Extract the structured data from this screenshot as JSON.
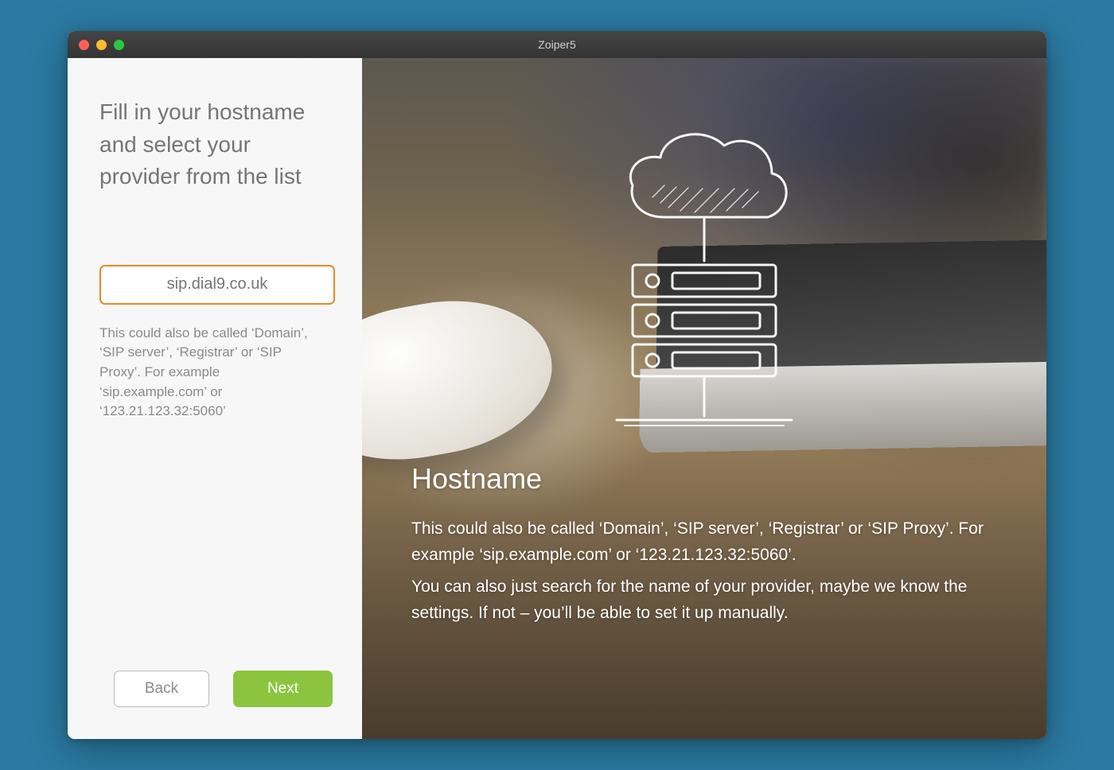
{
  "window": {
    "title": "Zoiper5"
  },
  "left": {
    "heading": "Fill in your hostname and select your provider from the list",
    "hostname_value": "sip.dial9.co.uk",
    "helper": "This could also be called ‘Domain’, ‘SIP server’, ‘Registrar’ or ‘SIP Proxy’. For example ‘sip.example.com’ or ‘123.21.123.32:5060’"
  },
  "buttons": {
    "back": "Back",
    "next": "Next"
  },
  "right": {
    "heading": "Hostname",
    "para1": "This could also be called ‘Domain’, ‘SIP server’, ‘Registrar’ or ‘SIP Proxy’. For example ‘sip.example.com’ or ‘123.21.123.32:5060’.",
    "para2": "You can also just search for the name of your provider, maybe we know the settings. If not – you’ll be able to set it up manually."
  }
}
